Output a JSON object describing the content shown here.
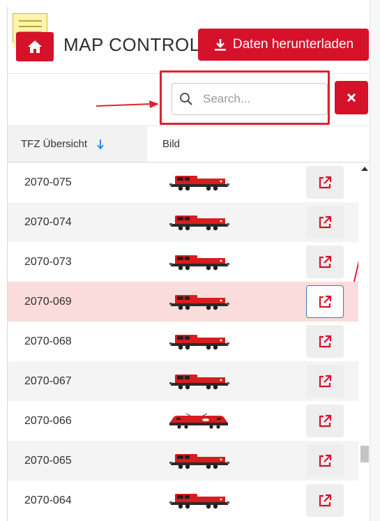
{
  "header": {
    "title": "MAP CONTROL",
    "download_label": "Daten herunterladen"
  },
  "search": {
    "placeholder": "Search..."
  },
  "table": {
    "columns": [
      "TFZ Übersicht",
      "Bild"
    ],
    "rows": [
      {
        "id": "2070-075",
        "image": "locomotive-hector"
      },
      {
        "id": "2070-074",
        "image": "locomotive-hector"
      },
      {
        "id": "2070-073",
        "image": "locomotive-hector"
      },
      {
        "id": "2070-069",
        "image": "locomotive-hector",
        "selected": true
      },
      {
        "id": "2070-068",
        "image": "locomotive-hector"
      },
      {
        "id": "2070-067",
        "image": "locomotive-hector"
      },
      {
        "id": "2070-066",
        "image": "locomotive-taurus"
      },
      {
        "id": "2070-065",
        "image": "locomotive-hector"
      },
      {
        "id": "2070-064",
        "image": "locomotive-hector"
      }
    ]
  },
  "icons": {
    "home": "home-icon",
    "download": "download-icon",
    "search": "search-icon",
    "clear": "close-icon",
    "sort": "arrow-down-icon",
    "open": "external-link-icon"
  },
  "colors": {
    "brand_red": "#d6112a",
    "highlight_row": "#fbdcdc",
    "focus_outline": "#3c78c8",
    "annotation_red": "#e0202f",
    "sort_arrow": "#2a7fd4"
  }
}
